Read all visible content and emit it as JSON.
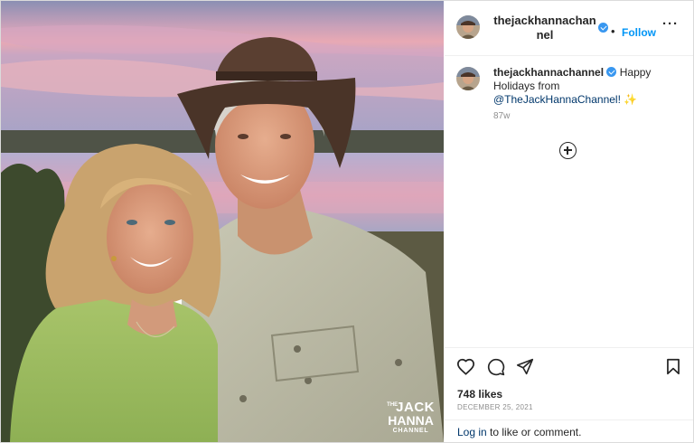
{
  "post": {
    "username": "thejackhannachannel",
    "follow_label": "Follow",
    "dot": "•",
    "more_label": "···",
    "caption": {
      "username": "thejackhannachannel",
      "text_before": "Happy Holidays from",
      "mention": "@TheJackHannaChannel!",
      "emoji": "✨",
      "age": "87w"
    },
    "likes": "748 likes",
    "date": "DECEMBER 25, 2021",
    "login": {
      "link": "Log in",
      "rest": "to like or comment."
    }
  },
  "watermark": {
    "the": "THE",
    "jack": "JACK",
    "hanna": "HANNA",
    "channel": "CHANNEL"
  },
  "icons": [
    "heart-icon",
    "comment-icon",
    "share-icon",
    "bookmark-icon",
    "add-circle-icon",
    "verified-icon",
    "more-icon"
  ],
  "colors": {
    "follow": "#0095f6",
    "verified": "#3897f0",
    "mention": "#00376b",
    "muted": "#8e8e8e",
    "border": "#dbdbdb"
  }
}
